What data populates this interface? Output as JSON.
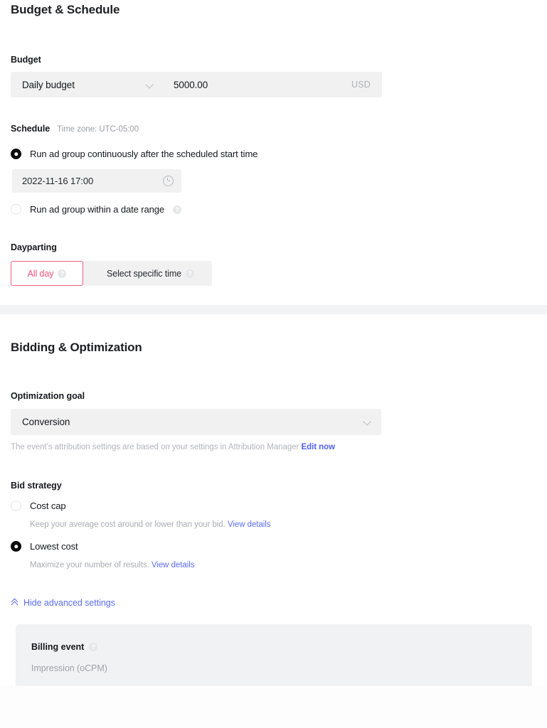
{
  "budget_schedule": {
    "section_title": "Budget & Schedule",
    "budget": {
      "label": "Budget",
      "type_value": "Daily budget",
      "amount_value": "5000.00",
      "currency": "USD",
      "chevron_icon": "chevron-down-icon"
    },
    "schedule": {
      "label": "Schedule",
      "timezone_note": "Time zone: UTC-05:00",
      "option_continuous": "Run ad group continuously after the scheduled start time",
      "option_continuous_selected": true,
      "start_time_value": "2022-11-16 17:00",
      "clock_icon": "clock-icon",
      "option_date_range": "Run ad group within a date range",
      "option_date_range_selected": false,
      "help_icon": "help-circle-icon"
    },
    "dayparting": {
      "label": "Dayparting",
      "tab_all_day": "All day",
      "tab_specific": "Select specific time",
      "active_tab": "All day",
      "active_color": "#f5517a",
      "active_border_color": "#f0607f"
    }
  },
  "bidding_optimization": {
    "section_title": "Bidding & Optimization",
    "optimization_goal": {
      "label": "Optimization goal",
      "value": "Conversion",
      "chevron_icon": "chevron-down-icon",
      "helper_text": "The event's attribution settings are based on your settings in Attribution Manager",
      "helper_link": "Edit now",
      "link_color": "#5b6ef5"
    },
    "bid_strategy": {
      "label": "Bid strategy",
      "options": [
        {
          "name": "Cost cap",
          "selected": false,
          "description": "Keep your average cost around or lower than your bid.",
          "link": "View details"
        },
        {
          "name": "Lowest cost",
          "selected": true,
          "description": "Maximize your number of results.",
          "link": "View details"
        }
      ]
    },
    "advanced": {
      "toggle_label": "Hide advanced settings",
      "toggle_icon": "double-chevron-up-icon",
      "billing_event_label": "Billing event",
      "billing_event_value": "Impression (oCPM)",
      "help_icon": "help-circle-icon"
    }
  }
}
